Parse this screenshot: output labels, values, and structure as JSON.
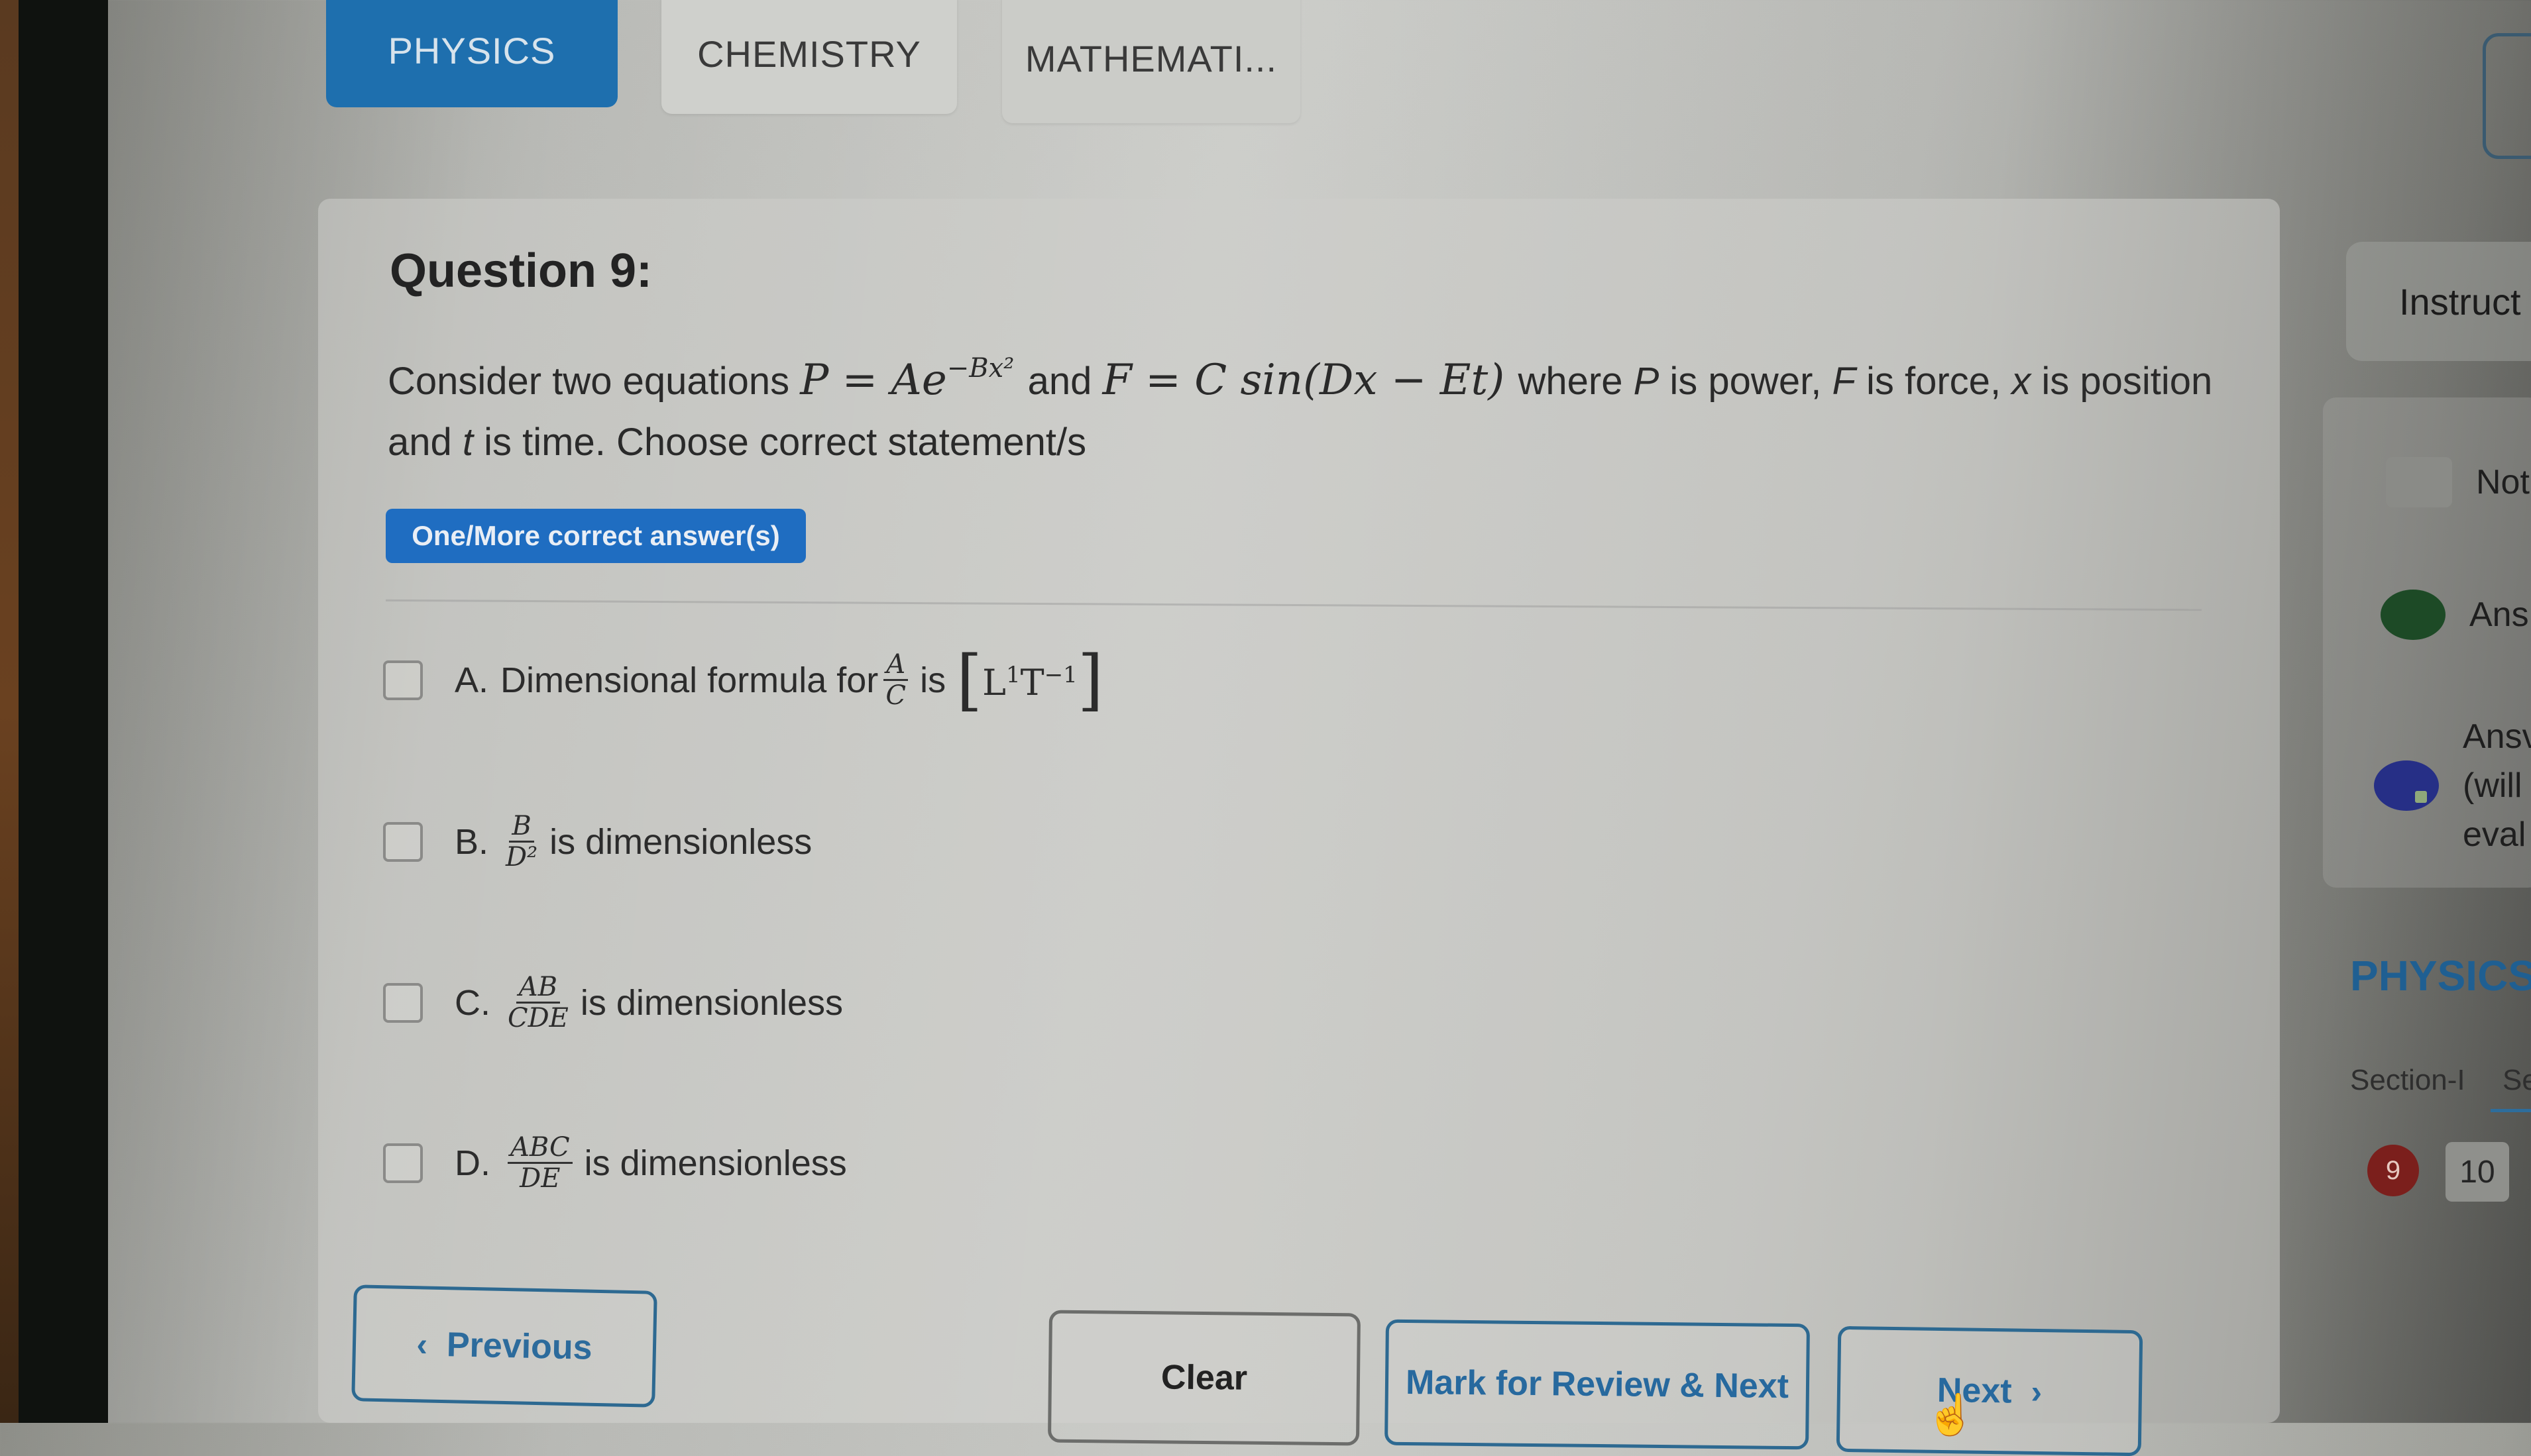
{
  "tabs": [
    {
      "label": "PHYSICS",
      "active": true
    },
    {
      "label": "CHEMISTRY",
      "active": false
    },
    {
      "label": "MATHEMATI...",
      "active": false
    }
  ],
  "question": {
    "title": "Question 9:",
    "text_part1": "Consider two equations",
    "eq1": {
      "lhs": "P",
      "rhs_base": "Ae",
      "exponent": "−Bx²"
    },
    "connector": "and",
    "eq2": {
      "lhs": "F",
      "rhs": "C sin(Dx − Et)"
    },
    "text_part2": "where",
    "var_P": "P",
    "text_P": "is power,",
    "var_F": "F",
    "text_F": "is force,",
    "var_x": "x",
    "text_x": "is position and",
    "var_t": "t",
    "text_t": "is time. Choose correct statement/s",
    "answer_type": "One/More correct answer(s)"
  },
  "options": [
    {
      "letter": "A.",
      "prefix": "Dimensional formula for",
      "frac_num": "A",
      "frac_den": "C",
      "suffix": "is",
      "dim_formula": {
        "L_exp": "1",
        "T_exp": "−1"
      },
      "checked": false
    },
    {
      "letter": "B.",
      "frac_num": "B",
      "frac_den": "D²",
      "suffix": "is dimensionless",
      "checked": false
    },
    {
      "letter": "C.",
      "frac_num": "AB",
      "frac_den": "CDE",
      "suffix": "is dimensionless",
      "checked": false
    },
    {
      "letter": "D.",
      "frac_num": "ABC",
      "frac_den": "DE",
      "suffix": "is dimensionless",
      "checked": false
    }
  ],
  "buttons": {
    "previous": "Previous",
    "clear": "Clear",
    "mark_review_next": "Mark for Review & Next",
    "next": "Next"
  },
  "sidebar": {
    "instructions": "Instruct",
    "legend": [
      {
        "label": "Not",
        "status": "not-visited"
      },
      {
        "label": "Ans",
        "status": "answered"
      },
      {
        "label_lines": [
          "Ansv",
          "(will",
          "eval"
        ],
        "status": "answered-marked"
      }
    ],
    "subject": "PHYSICS",
    "sections": [
      "Section-I",
      "Se"
    ],
    "questions": [
      {
        "number": "9",
        "status": "current"
      },
      {
        "number": "10",
        "status": "not-visited"
      }
    ]
  },
  "colors": {
    "accent": "#1e6fae",
    "tag_bg": "#1f6dc1",
    "answered": "#1d4a26",
    "marked": "#262f86",
    "current_question": "#7b1f1c"
  }
}
